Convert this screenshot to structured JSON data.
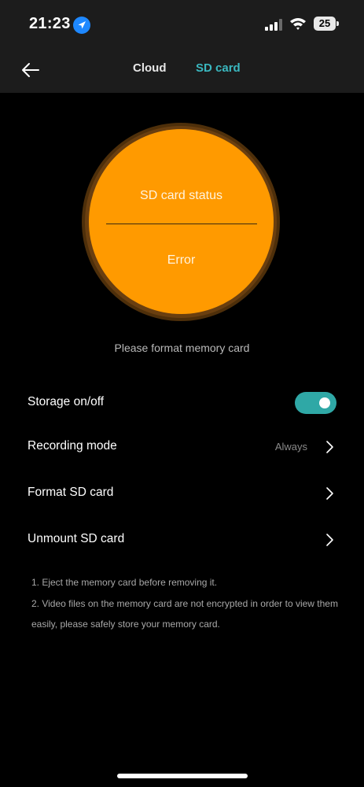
{
  "status_bar": {
    "time": "21:23",
    "battery": "25",
    "location_icon": "location-arrow-icon",
    "signal_icon": "cellular-signal-icon",
    "wifi_icon": "wifi-icon"
  },
  "header": {
    "back_icon": "back-arrow-icon",
    "tabs": [
      {
        "label": "Cloud",
        "active": false
      },
      {
        "label": "SD card",
        "active": true
      }
    ]
  },
  "status_circle": {
    "title": "SD card status",
    "value": "Error",
    "color": "#ff9a00"
  },
  "hint": "Please format memory card",
  "settings": {
    "storage": {
      "label": "Storage on/off",
      "enabled": true
    },
    "recording_mode": {
      "label": "Recording mode",
      "value": "Always"
    },
    "format": {
      "label": "Format SD card"
    },
    "unmount": {
      "label": "Unmount SD card"
    }
  },
  "notes": [
    "1. Eject the memory card before removing it.",
    "2. Video files on the memory card are not encrypted in order to view them easily, please safely store your memory card."
  ],
  "colors": {
    "accent": "#3ab7bf",
    "toggle_on": "#2fa8a6",
    "header_bg": "#1c1c1c",
    "background": "#000000"
  }
}
